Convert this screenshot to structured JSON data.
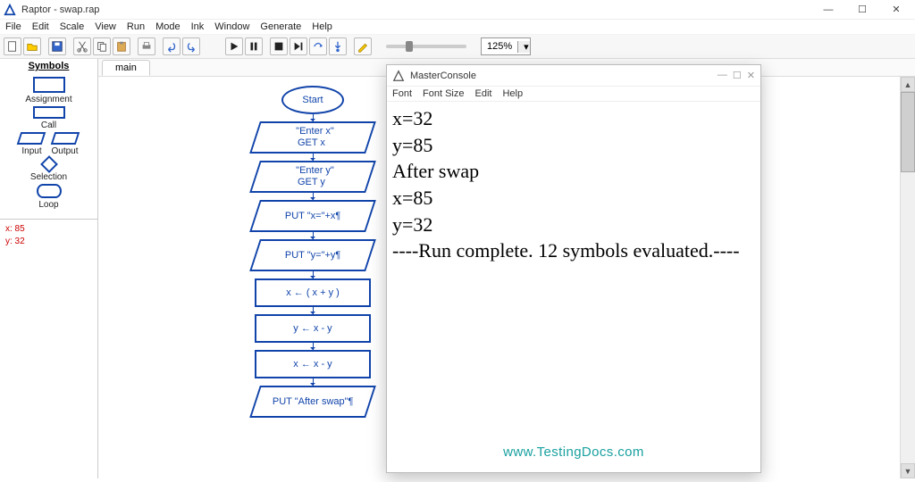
{
  "app": {
    "title": "Raptor - swap.rap"
  },
  "menu": [
    "File",
    "Edit",
    "Scale",
    "View",
    "Run",
    "Mode",
    "Ink",
    "Window",
    "Generate",
    "Help"
  ],
  "toolbar_icons": [
    "new",
    "open",
    "save",
    "cut",
    "copy",
    "paste",
    "print",
    "undo",
    "redo",
    "run",
    "pause",
    "stop",
    "step-over",
    "step-into",
    "step-to-cursor",
    "pencil"
  ],
  "zoom": {
    "value": "125%"
  },
  "symbols": {
    "header": "Symbols",
    "assignment": "Assignment",
    "call": "Call",
    "input": "Input",
    "output": "Output",
    "selection": "Selection",
    "loop": "Loop"
  },
  "watch": {
    "line1": "x: 85",
    "line2": "y: 32"
  },
  "tab": {
    "main": "main"
  },
  "flow": {
    "start": "Start",
    "n1a": "\"Enter x\"",
    "n1b": "GET x",
    "n2a": "\"Enter y\"",
    "n2b": "GET y",
    "n3": "PUT \"x=\"+x¶",
    "n4": "PUT \"y=\"+y¶",
    "n5": "x ← ( x + y )",
    "n6": "y ← x - y",
    "n7": "x ← x - y",
    "n8": "PUT \"After swap\"¶"
  },
  "console": {
    "title": "MasterConsole",
    "menu": [
      "Font",
      "Font Size",
      "Edit",
      "Help"
    ],
    "lines": [
      "x=32",
      "y=85",
      "After swap",
      "x=85",
      "y=32",
      "----Run complete.  12 symbols evaluated.----"
    ]
  },
  "watermark": "www.TestingDocs.com"
}
